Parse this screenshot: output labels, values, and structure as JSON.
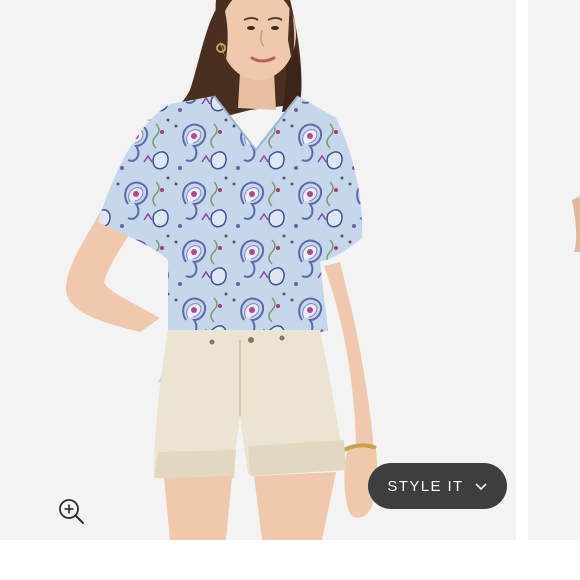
{
  "product_gallery": {
    "main_image": {
      "subject": "model-wearing-paisley-split-neck-top-and-cream-cuffed-shorts"
    },
    "zoom": {
      "icon": "zoom-in-icon"
    },
    "style_it": {
      "label": "STYLE IT",
      "icon": "chevron-down-icon",
      "background": "#3e3e40",
      "text_color": "#ffffff"
    }
  },
  "colors": {
    "background": "#f3f3f3",
    "top_base": "#c8d8ec",
    "shorts": "#ece4d2"
  }
}
